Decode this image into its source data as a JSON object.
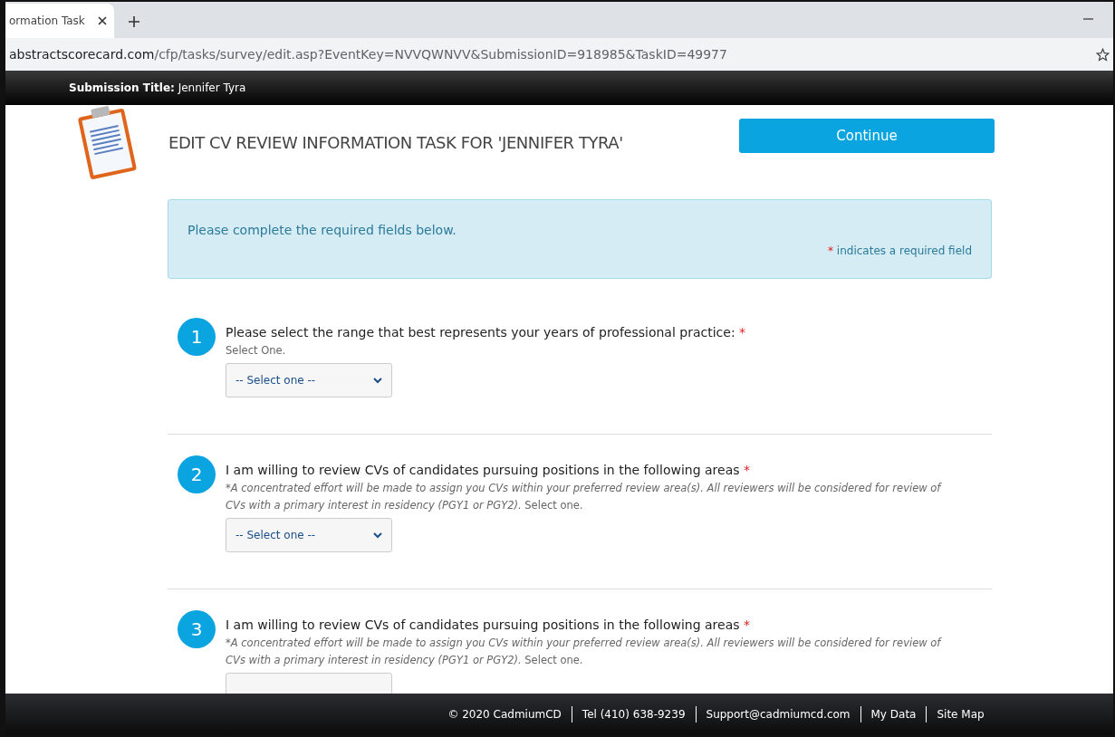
{
  "browser": {
    "tab_title": "ormation Task",
    "url_domain": "abstractscorecard.com",
    "url_path": "/cfp/tasks/survey/edit.asp?EventKey=NVVQWNVV&SubmissionID=918985&TaskID=49977"
  },
  "header_bar": {
    "label": "Submission Title:",
    "value": "Jennifer Tyra"
  },
  "page": {
    "title": "EDIT CV REVIEW INFORMATION TASK FOR 'JENNIFER TYRA'",
    "continue_button": "Continue"
  },
  "alert": {
    "message": "Please complete the required fields below.",
    "required_mark": "*",
    "required_note": "indicates a required field"
  },
  "questions": [
    {
      "number": "1",
      "text": "Please select the range that best represents your years of professional practice:",
      "required_mark": "*",
      "help": "Select One.",
      "select_value": "-- Select one --"
    },
    {
      "number": "2",
      "text": "I am willing to review CVs of candidates pursuing positions in the following areas",
      "required_mark": "*",
      "help_note": "*A concentrated effort will be made to assign you CVs within your preferred review area(s). All reviewers will be considered for review of CVs with a primary interest in residency (PGY1 or PGY2).",
      "help": "Select one.",
      "select_value": "-- Select one --"
    },
    {
      "number": "3",
      "text": "I am willing to review CVs of candidates pursuing positions in the following areas",
      "required_mark": "*",
      "help_note": "*A concentrated effort will be made to assign you CVs within your preferred review area(s). All reviewers will be considered for review of CVs with a primary interest in residency (PGY1 or PGY2).",
      "help": "Select one."
    }
  ],
  "footer": {
    "links": [
      "© 2020 CadmiumCD",
      "Tel (410) 638-9239",
      "Support@cadmiumcd.com",
      "My Data",
      "Site Map"
    ]
  }
}
